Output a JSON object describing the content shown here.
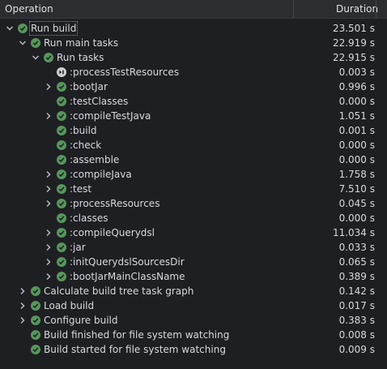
{
  "header": {
    "operation": "Operation",
    "duration": "Duration"
  },
  "rows": [
    {
      "label": "Run build",
      "duration": "23.501 s",
      "level": 0,
      "chevron": "down",
      "status": "success"
    },
    {
      "label": "Run main tasks",
      "duration": "22.919 s",
      "level": 1,
      "chevron": "down",
      "status": "success"
    },
    {
      "label": "Run tasks",
      "duration": "22.915 s",
      "level": 2,
      "chevron": "down",
      "status": "success"
    },
    {
      "label": ":processTestResources",
      "duration": "0.003 s",
      "level": 3,
      "chevron": "none",
      "status": "skipped"
    },
    {
      "label": ":bootJar",
      "duration": "0.996 s",
      "level": 3,
      "chevron": "right",
      "status": "success"
    },
    {
      "label": ":testClasses",
      "duration": "0.000 s",
      "level": 3,
      "chevron": "none",
      "status": "success"
    },
    {
      "label": ":compileTestJava",
      "duration": "1.051 s",
      "level": 3,
      "chevron": "right",
      "status": "success"
    },
    {
      "label": ":build",
      "duration": "0.001 s",
      "level": 3,
      "chevron": "none",
      "status": "success"
    },
    {
      "label": ":check",
      "duration": "0.000 s",
      "level": 3,
      "chevron": "none",
      "status": "success"
    },
    {
      "label": ":assemble",
      "duration": "0.000 s",
      "level": 3,
      "chevron": "none",
      "status": "success"
    },
    {
      "label": ":compileJava",
      "duration": "1.758 s",
      "level": 3,
      "chevron": "right",
      "status": "success"
    },
    {
      "label": ":test",
      "duration": "7.510 s",
      "level": 3,
      "chevron": "right",
      "status": "success"
    },
    {
      "label": ":processResources",
      "duration": "0.045 s",
      "level": 3,
      "chevron": "right",
      "status": "success"
    },
    {
      "label": ":classes",
      "duration": "0.000 s",
      "level": 3,
      "chevron": "none",
      "status": "success"
    },
    {
      "label": ":compileQuerydsl",
      "duration": "11.034 s",
      "level": 3,
      "chevron": "right",
      "status": "success"
    },
    {
      "label": ":jar",
      "duration": "0.033 s",
      "level": 3,
      "chevron": "right",
      "status": "success"
    },
    {
      "label": ":initQuerydslSourcesDir",
      "duration": "0.065 s",
      "level": 3,
      "chevron": "right",
      "status": "success"
    },
    {
      "label": ":bootJarMainClassName",
      "duration": "0.389 s",
      "level": 3,
      "chevron": "right",
      "status": "success"
    },
    {
      "label": "Calculate build tree task graph",
      "duration": "0.142 s",
      "level": 1,
      "chevron": "right",
      "status": "success"
    },
    {
      "label": "Load build",
      "duration": "0.017 s",
      "level": 1,
      "chevron": "right",
      "status": "success"
    },
    {
      "label": "Configure build",
      "duration": "0.383 s",
      "level": 1,
      "chevron": "right",
      "status": "success"
    },
    {
      "label": "Build finished for file system watching",
      "duration": "0.008 s",
      "level": 1,
      "chevron": "none",
      "status": "success"
    },
    {
      "label": "Build started for file system watching",
      "duration": "0.009 s",
      "level": 1,
      "chevron": "none",
      "status": "success"
    }
  ],
  "selected_index": 0,
  "colors": {
    "success": "#57965c",
    "skipped": "#cfd1d4",
    "background": "#1e1f22",
    "header": "#2b2d30"
  },
  "icons": {
    "success": "check-circle-icon",
    "skipped": "skipped-circle-icon",
    "expand": "chevron-right-icon",
    "collapse": "chevron-down-icon"
  }
}
